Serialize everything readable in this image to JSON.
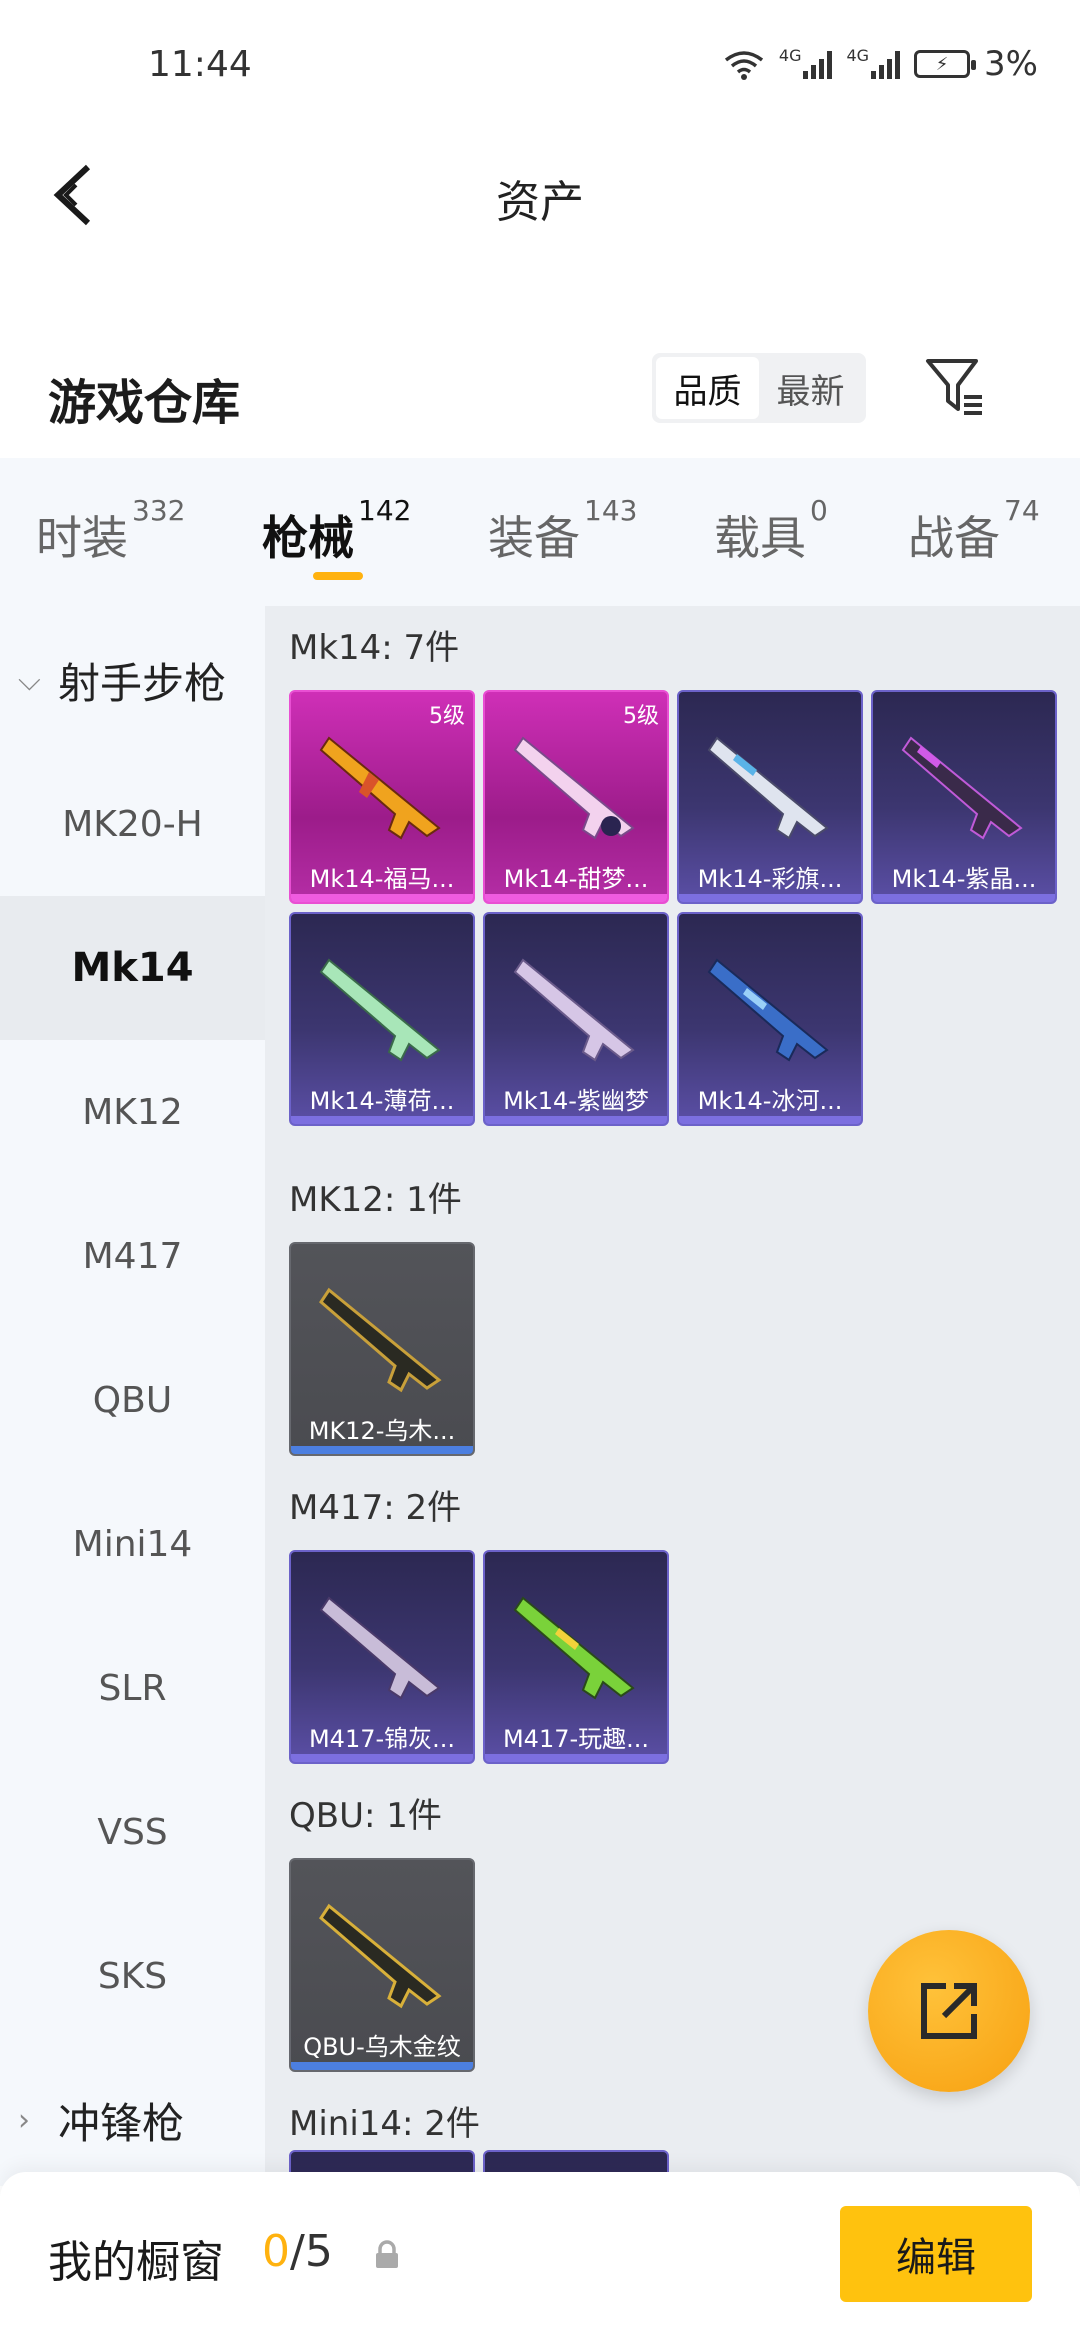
{
  "status_bar": {
    "time": "11:44",
    "battery": "3%",
    "net1": "4G",
    "net2": "4G"
  },
  "nav": {
    "title": "资产"
  },
  "section": {
    "title": "游戏仓库",
    "sort_options": [
      "品质",
      "最新"
    ],
    "sort_selected": "品质"
  },
  "tabs": [
    {
      "label": "时装",
      "count": "332"
    },
    {
      "label": "枪械",
      "count": "142",
      "active": true
    },
    {
      "label": "装备",
      "count": "143"
    },
    {
      "label": "载具",
      "count": "0"
    },
    {
      "label": "战备",
      "count": "74"
    }
  ],
  "sidebar": {
    "groups": [
      {
        "label": "射手步枪",
        "expanded": true
      },
      {
        "label": "冲锋枪",
        "expanded": false
      }
    ],
    "items": [
      "MK20-H",
      "Mk14",
      "MK12",
      "M417",
      "QBU",
      "Mini14",
      "SLR",
      "VSS",
      "SKS"
    ],
    "selected": "Mk14"
  },
  "content": {
    "groups": [
      {
        "label": "Mk14: 7件",
        "items": [
          {
            "name": "Mk14-福马...",
            "level": "5级",
            "tier": "pink"
          },
          {
            "name": "Mk14-甜梦...",
            "level": "5级",
            "tier": "pink"
          },
          {
            "name": "Mk14-彩旗...",
            "tier": "purple"
          },
          {
            "name": "Mk14-紫晶...",
            "tier": "purple"
          },
          {
            "name": "Mk14-薄荷...",
            "tier": "purple"
          },
          {
            "name": "Mk14-紫幽梦",
            "tier": "purple"
          },
          {
            "name": "Mk14-冰河...",
            "tier": "purple"
          }
        ]
      },
      {
        "label": "MK12: 1件",
        "items": [
          {
            "name": "MK12-乌木...",
            "tier": "gray"
          }
        ]
      },
      {
        "label": "M417: 2件",
        "items": [
          {
            "name": "M417-锦灰...",
            "tier": "purple"
          },
          {
            "name": "M417-玩趣...",
            "tier": "purple"
          }
        ]
      },
      {
        "label": "QBU: 1件",
        "items": [
          {
            "name": "QBU-乌木金纹",
            "tier": "gray"
          }
        ]
      },
      {
        "label": "Mini14: 2件",
        "items": []
      }
    ]
  },
  "bottom": {
    "showcase_label": "我的橱窗",
    "showcase_used": "0",
    "showcase_total": "/5",
    "edit_label": "编辑"
  },
  "colors": {
    "accent": "#ffb20f",
    "edit_button": "#ffc20e"
  }
}
